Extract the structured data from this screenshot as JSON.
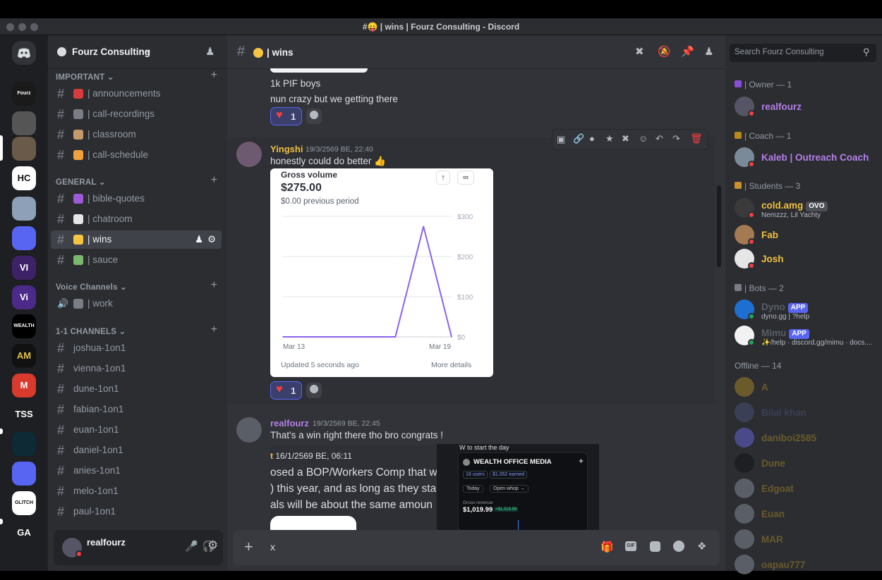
{
  "window": {
    "title": "#😛 | wins | Fourz Consulting - Discord"
  },
  "servers": [
    {
      "label": "Fourz",
      "bg": "#1a1a1a"
    },
    {
      "label": "",
      "bg": "#555"
    },
    {
      "label": "",
      "bg": "#6a5a4a"
    },
    {
      "label": "HC",
      "bg": "#ffffff",
      "fg": "#111"
    },
    {
      "label": "",
      "bg": "#8da0b8"
    },
    {
      "label": "",
      "bg": "#5865f2"
    },
    {
      "label": "VI",
      "bg": "#3e2268"
    },
    {
      "label": "Vi",
      "bg": "#4b2a8a"
    },
    {
      "label": "WEALTH",
      "bg": "#000000"
    },
    {
      "label": "AM",
      "bg": "#111111",
      "fg": "#e4c047"
    },
    {
      "label": "M",
      "bg": "#d83a2e"
    },
    {
      "label": "TSS",
      "bg": "#1e1f22"
    },
    {
      "label": "",
      "bg": "#0d2a35"
    },
    {
      "label": "",
      "bg": "#5865f2"
    },
    {
      "label": "GLITCH",
      "bg": "#ffffff",
      "fg": "#111"
    },
    {
      "label": "GA",
      "bg": "#1e1f22"
    }
  ],
  "guild": {
    "name": "Fourz Consulting"
  },
  "categories": {
    "important": "IMPORTANT",
    "general": "GENERAL",
    "voice": "Voice Channels",
    "one_on_one": "1-1 CHANNELS"
  },
  "channels_important": [
    {
      "name": "announcements",
      "emoji_color": "#d63c3c"
    },
    {
      "name": "call-recordings",
      "emoji_color": "#7a7d85"
    },
    {
      "name": "classroom",
      "emoji_color": "#c49a6c"
    },
    {
      "name": "call-schedule",
      "emoji_color": "#f0a13c"
    }
  ],
  "channels_general": [
    {
      "name": "bible-quotes",
      "emoji_color": "#9c5ad6"
    },
    {
      "name": "chatroom",
      "emoji_color": "#e6e6e6"
    },
    {
      "name": "wins",
      "emoji_color": "#f5c542"
    },
    {
      "name": "sauce",
      "emoji_color": "#7ab86d"
    }
  ],
  "voice_channels": [
    {
      "name": "work"
    }
  ],
  "channels_1on1": [
    "joshua-1on1",
    "vienna-1on1",
    "dune-1on1",
    "fabian-1on1",
    "euan-1on1",
    "daniel-1on1",
    "anies-1on1",
    "melo-1on1",
    "paul-1on1"
  ],
  "user": {
    "name": "realfourz"
  },
  "channel": {
    "name": "wins",
    "search_placeholder": "Search Fourz Consulting"
  },
  "messages": {
    "m0_line1": "1k PIF boys",
    "m0_line2": "nun crazy but we getting there",
    "m0_reaction_count": "1",
    "m1_author": "Yingshi",
    "m1_time": "19/3/2569 BE, 22:40",
    "m1_text": "honestly could do better",
    "m1_reaction_count": "1",
    "m2_author": "realfourz",
    "m2_time": "19/3/2569 BE, 22:45",
    "m2_text": "That's a win right there tho bro congrats !",
    "embed_time": "16/1/2569 BE, 06:11",
    "embed_line1": "osed a BOP/Workers Comp that w",
    "embed_line2": ") this year, and as long as they sta",
    "embed_line3": "als will be about the same amoun",
    "embed_top": "W to start the day",
    "embed_brand": "WEALTH OFFICE MEDIA",
    "embed_users": "18 users",
    "embed_earned": "$1,052 earned",
    "embed_today": "Today",
    "embed_open": "Open whop →",
    "embed_gross_label": "Gross revenue",
    "embed_gross_value": "$1,019.99",
    "embed_gross_badge": "+$1,019.99"
  },
  "composer": {
    "value": "x"
  },
  "chart_card": {
    "title": "Gross volume",
    "value": "$275.00",
    "previous": "$0.00 previous period",
    "updated": "Updated 5 seconds ago",
    "more": "More details"
  },
  "chart_data": {
    "type": "line",
    "title": "Gross volume",
    "x": [
      "Mar 13",
      "Mar 14",
      "Mar 15",
      "Mar 16",
      "Mar 17",
      "Mar 18",
      "Mar 19"
    ],
    "x_tick_labels": [
      "Mar 13",
      "Mar 19"
    ],
    "series": [
      {
        "values": [
          0,
          0,
          0,
          0,
          0,
          275,
          0
        ]
      }
    ],
    "y_tick_labels": [
      "$300",
      "$200",
      "$100",
      "$0"
    ],
    "ylim": [
      0,
      300
    ],
    "color": "#8a63f0",
    "grid": true
  },
  "members": {
    "owner_head": "| Owner — 1",
    "owner": [
      {
        "name": "realfourz",
        "color": "#b57ee8"
      }
    ],
    "coach_head": "| Coach — 1",
    "coach": [
      {
        "name": "Kaleb | Outreach Coach",
        "color": "#b57ee8"
      }
    ],
    "students_head": "| Students — 3",
    "students": [
      {
        "name": "cold.amg",
        "color": "#f0c03c",
        "tag": "OVO",
        "activity": "Nemzzz, Lil Yachty"
      },
      {
        "name": "Fab",
        "color": "#f0c03c"
      },
      {
        "name": "Josh",
        "color": "#f0c03c"
      }
    ],
    "bots_head": "| Bots — 2",
    "bots": [
      {
        "name": "Dyno",
        "color": "#5a5e66",
        "tag": "APP",
        "activity": "dyno.gg | ?help"
      },
      {
        "name": "Mimu",
        "color": "#5a5e66",
        "tag": "APP",
        "activity": "✨/help · discord.gg/mimu · docs...."
      }
    ],
    "offline_head": "Offline — 14",
    "offline": [
      {
        "name": "A",
        "color": "#6b5a2a"
      },
      {
        "name": "Bilal khan",
        "color": "#3a3f56"
      },
      {
        "name": "daniboi2585",
        "color": "#6b5a2a"
      },
      {
        "name": "Dune",
        "color": "#6b5a2a"
      },
      {
        "name": "Edgoat",
        "color": "#6b5a2a"
      },
      {
        "name": "Euan",
        "color": "#6b5a2a"
      },
      {
        "name": "MAR",
        "color": "#6b5a2a"
      },
      {
        "name": "oapau777",
        "color": "#6b5a2a"
      }
    ]
  }
}
